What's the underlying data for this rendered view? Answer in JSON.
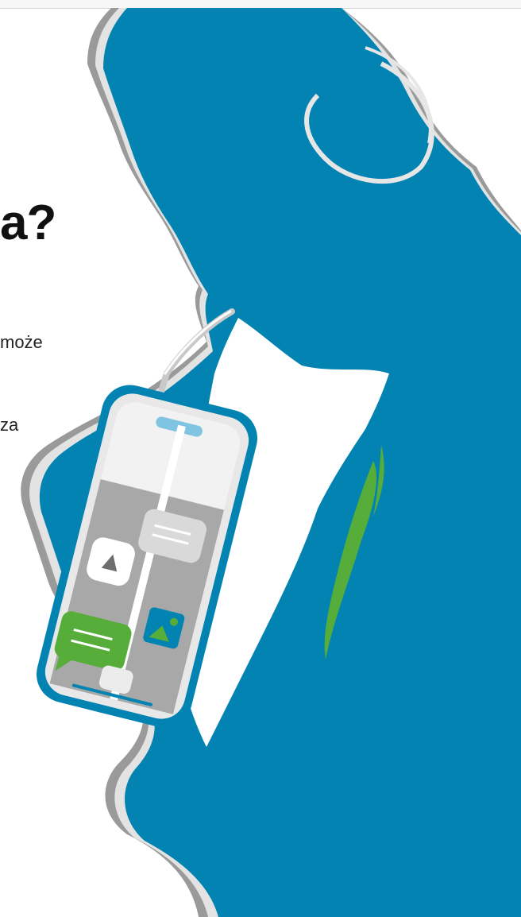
{
  "hero": {
    "heading_fragment": "a?",
    "text_fragments": [
      "może",
      "za"
    ]
  },
  "colors": {
    "figure_blue": "#0383b2",
    "accent_green": "#56ad3a",
    "phone_gray": "#a9a9a9",
    "shadow_gray": "#8c8c8c",
    "light_gray": "#e6e6e6"
  },
  "icons": [
    "play-icon",
    "chat-bubble-icon",
    "image-icon",
    "straw-icon"
  ]
}
